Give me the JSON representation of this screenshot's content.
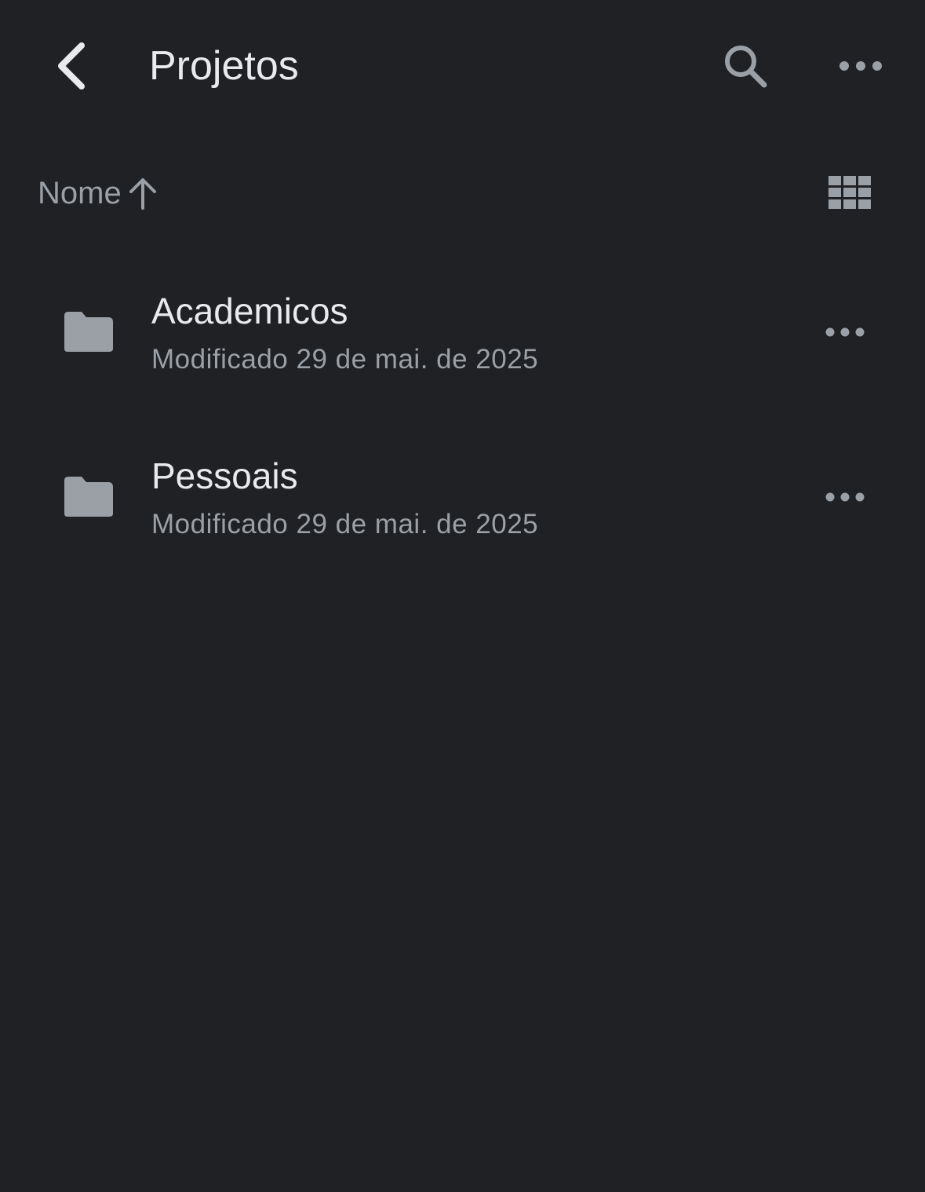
{
  "header": {
    "title": "Projetos",
    "back_icon": "chevron-left-icon",
    "search_icon": "search-icon",
    "more_icon": "more-horizontal-icon"
  },
  "sort": {
    "label": "Nome",
    "direction_icon": "arrow-up-icon",
    "view_icon": "grid-view-icon"
  },
  "items": [
    {
      "name": "Academicos",
      "meta": "Modificado 29 de mai. de 2025",
      "icon": "folder-icon"
    },
    {
      "name": "Pessoais",
      "meta": "Modificado 29 de mai. de 2025",
      "icon": "folder-icon"
    }
  ],
  "colors": {
    "background": "#202124",
    "primary_text": "#e8eaed",
    "secondary_text": "#9aa0a6"
  }
}
